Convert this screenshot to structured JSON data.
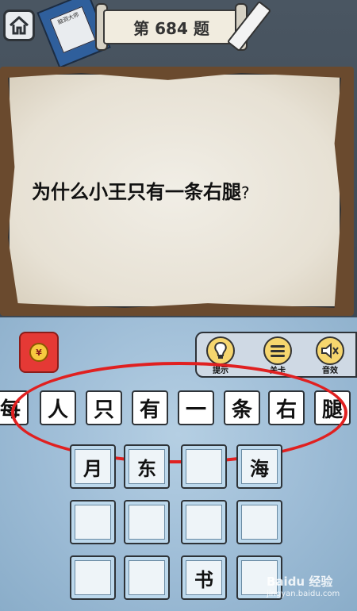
{
  "header": {
    "level_title": "第 684 题",
    "book_text": "脑洞大师"
  },
  "question": {
    "text": "为什么小王只有一条右腿",
    "mark": "?"
  },
  "tools": [
    {
      "label": "提示",
      "icon": "lightbulb-icon"
    },
    {
      "label": "关卡",
      "icon": "menu-list-icon"
    },
    {
      "label": "音效",
      "icon": "speaker-muted-icon"
    }
  ],
  "reward": {
    "icon": "red-packet-icon",
    "symbol": "¥"
  },
  "answer_row": [
    "每",
    "人",
    "只",
    "有",
    "一",
    "条",
    "右",
    "腿"
  ],
  "choice_grid": [
    [
      "月",
      "东",
      "",
      "海"
    ],
    [
      "",
      "",
      "",
      ""
    ],
    [
      "",
      "",
      "书",
      ""
    ]
  ],
  "watermark": {
    "main": "Baidu 经验",
    "sub": "jingyan.baidu.com"
  },
  "colors": {
    "highlight_oval": "#e02020",
    "tool_yellow": "#f6d66e",
    "red_packet": "#e53935"
  }
}
